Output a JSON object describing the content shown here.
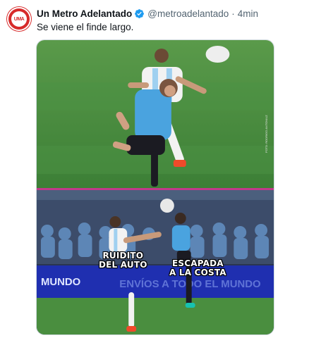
{
  "tweet": {
    "display_name": "Un Metro Adelantado",
    "handle": "@metroadelantado",
    "separator": "·",
    "time": "4min",
    "text": "Se viene el finde largo.",
    "avatar_text": "UMA"
  },
  "media": {
    "credit": "FOTO: RODRIGO ANTONIUZ",
    "label_left": "RUIDITO\nDEL AUTO",
    "label_right": "ESCAPADA\nA LA COSTA",
    "board_text_left": "MUNDO",
    "board_text_right": "ENVÍOS A TODO EL MUNDO"
  },
  "colors": {
    "verified": "#1d9bf0",
    "avatar": "#d72a2a",
    "divider": "#c13a8a",
    "grass": "#3f8a3a",
    "sky_blue_jersey": "#4aa3df"
  }
}
